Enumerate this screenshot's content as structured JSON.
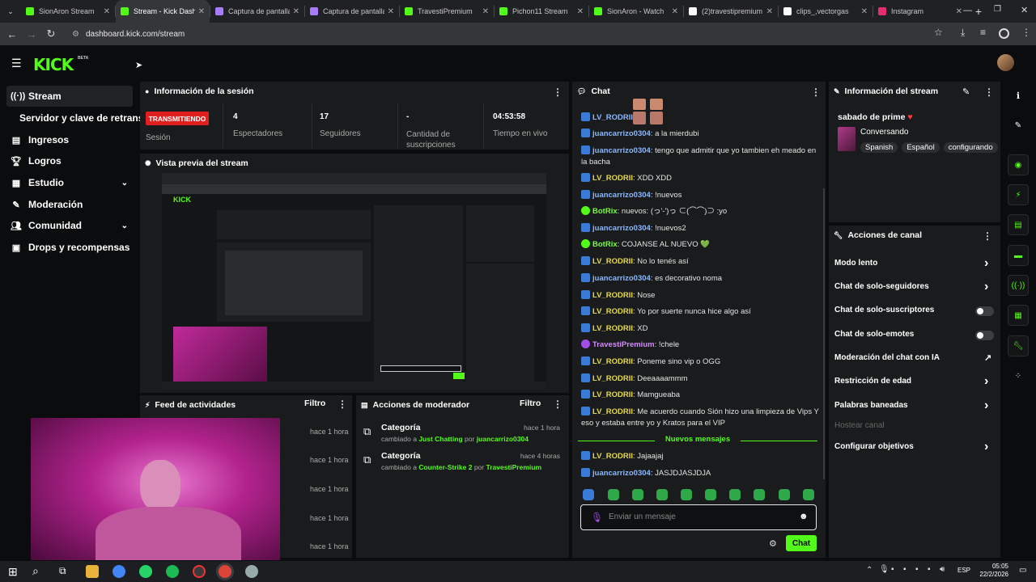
{
  "browser": {
    "tabs": [
      {
        "title": "SionAron Stream",
        "fav": "#53fc18"
      },
      {
        "title": "Stream - Kick Dashboard",
        "fav": "#53fc18",
        "active": true
      },
      {
        "title": "Captura de pantalla",
        "fav": "#a87cff"
      },
      {
        "title": "Captura de pantalla",
        "fav": "#a87cff"
      },
      {
        "title": "TravestiPremium",
        "fav": "#53fc18"
      },
      {
        "title": "Pichon11 Stream",
        "fav": "#53fc18"
      },
      {
        "title": "SionAron - Watch",
        "fav": "#53fc18"
      },
      {
        "title": "(2)travestipremium",
        "fav": "#ffffff"
      },
      {
        "title": "clips_,vectorgas",
        "fav": "#ffffff"
      },
      {
        "title": "Instagram",
        "fav": "#e1306c"
      }
    ],
    "new_tab": "+",
    "url": "dashboard.kick.com/stream",
    "icons": {
      "back": "arrow-left-icon",
      "forward": "arrow-right-icon",
      "reload": "reload-icon"
    }
  },
  "header": {
    "logo": "KICK",
    "beta": "BETA"
  },
  "sidebar": {
    "items": [
      {
        "label": "Stream",
        "icon": "((·))",
        "active": true
      },
      {
        "label": "Servidor y clave de retransmisión",
        "sub": true
      },
      {
        "label": "Ingresos",
        "icon": "▤"
      },
      {
        "label": "Logros",
        "icon": "🏆︎"
      },
      {
        "label": "Estudio",
        "icon": "▦",
        "expand": true
      },
      {
        "label": "Moderación",
        "icon": "✎"
      },
      {
        "label": "Comunidad",
        "icon": "👥︎",
        "expand": true
      },
      {
        "label": "Drops y recompensas",
        "icon": "▣"
      }
    ]
  },
  "session": {
    "title": "Información de la sesión",
    "live_badge": "TRANSMITIENDO",
    "session_label": "Sesión",
    "stats": [
      {
        "value": "4",
        "label": "Espectadores"
      },
      {
        "value": "17",
        "label": "Seguidores"
      },
      {
        "value": "-",
        "label": "Cantidad de suscripciones"
      },
      {
        "value": "04:53:58",
        "label": "Tiempo en vivo"
      }
    ]
  },
  "preview": {
    "title": "Vista previa del stream"
  },
  "feed": {
    "title": "Feed de actividades",
    "filter": "Filtro",
    "times": [
      "hace 1 hora",
      "hace 1 hora",
      "hace 1 hora",
      "hace 1 hora",
      "hace 1 hora"
    ]
  },
  "modactions": {
    "title": "Acciones de moderador",
    "filter": "Filtro",
    "rows": [
      {
        "title": "Categoría",
        "time": "hace 1 hora",
        "prefix": "cambiado a",
        "target": "Just Chatting",
        "by": "por",
        "user": "juancarrizo0304"
      },
      {
        "title": "Categoría",
        "time": "hace 4 horas",
        "prefix": "cambiado a",
        "target": "Counter-Strike 2",
        "by": "por",
        "user": "TravestiPremium"
      }
    ]
  },
  "chat": {
    "title": "Chat",
    "messages": [
      {
        "user": "LV_RODRII",
        "text": "",
        "color": "blue",
        "badge": "b"
      },
      {
        "user": "juancarrizo0304",
        "text": "a la mierdubi",
        "color": "blue",
        "badge": "b"
      },
      {
        "user": "juancarrizo0304",
        "text": "tengo que admitir que yo tambien eh meado en la bacha",
        "color": "blue",
        "badge": "b"
      },
      {
        "user": "LV_RODRII",
        "text": "XDD XDD",
        "color": "yellow",
        "badge": "b"
      },
      {
        "user": "juancarrizo0304",
        "text": "!nuevos",
        "color": "blue",
        "badge": "b"
      },
      {
        "user": "BotRix",
        "text": "nuevos: (っ'-')っ ⊂(⌒⌒)⊃ :yo",
        "color": "green",
        "badge": "g"
      },
      {
        "user": "juancarrizo0304",
        "text": "!nuevos2",
        "color": "blue",
        "badge": "b"
      },
      {
        "user": "BotRix",
        "text": "COJANSE AL NUEVO 💚",
        "color": "green",
        "badge": "g"
      },
      {
        "user": "LV_RODRII",
        "text": "No lo tenés así",
        "color": "yellow",
        "badge": "b"
      },
      {
        "user": "juancarrizo0304",
        "text": "es decorativo noma",
        "color": "blue",
        "badge": "b"
      },
      {
        "user": "LV_RODRII",
        "text": "Nose",
        "color": "yellow",
        "badge": "b"
      },
      {
        "user": "LV_RODRII",
        "text": "Yo por suerte nunca hice algo así",
        "color": "yellow",
        "badge": "b"
      },
      {
        "user": "LV_RODRII",
        "text": "XD",
        "color": "yellow",
        "badge": "b"
      },
      {
        "user": "TravestiPremium",
        "text": "!chele",
        "color": "purple",
        "badge": "p"
      },
      {
        "user": "LV_RODRII",
        "text": "Poneme sino vip o OGG",
        "color": "yellow",
        "badge": "b"
      },
      {
        "user": "LV_RODRII",
        "text": "Deeaaaammm",
        "color": "yellow",
        "badge": "b"
      },
      {
        "user": "LV_RODRII",
        "text": "Mamgueaba",
        "color": "yellow",
        "badge": "b"
      },
      {
        "user": "LV_RODRII",
        "text": "Me acuerdo cuando Sión hizo una limpieza de Vips Y eso y estaba entre yo y Kratos para el VIP",
        "color": "yellow",
        "badge": "b"
      }
    ],
    "new_messages": "Nuevos mensajes",
    "new": [
      {
        "user": "LV_RODRII",
        "text": "Jajaajaj",
        "color": "yellow",
        "badge": "b"
      },
      {
        "user": "juancarrizo0304",
        "text": "JASJDJASJDJA",
        "color": "blue",
        "badge": "b"
      }
    ],
    "input_placeholder": "Enviar un mensaje",
    "send_label": "Chat"
  },
  "stream_info": {
    "title": "Información del stream",
    "stream_title": "sabado de prime",
    "category": "Conversando",
    "tags": [
      "Spanish",
      "Español",
      "configurando"
    ]
  },
  "channel_actions": {
    "title": "Acciones de canal",
    "items": [
      {
        "label": "Modo lento",
        "control": "arrow"
      },
      {
        "label": "Chat de solo-seguidores",
        "control": "arrow"
      },
      {
        "label": "Chat de solo-suscriptores",
        "control": "toggle"
      },
      {
        "label": "Chat de solo-emotes",
        "control": "toggle"
      },
      {
        "label": "Moderación del chat con IA",
        "control": "link"
      },
      {
        "label": "Restricción de edad",
        "control": "arrow"
      },
      {
        "label": "Palabras baneadas",
        "control": "arrow"
      },
      {
        "label": "Hostear canal",
        "control": "none",
        "disabled": true
      },
      {
        "label": "Configurar objetivos",
        "control": "arrow"
      }
    ]
  },
  "taskbar": {
    "lang": "ESP",
    "time": "05:05",
    "date": "22/2/2026"
  }
}
